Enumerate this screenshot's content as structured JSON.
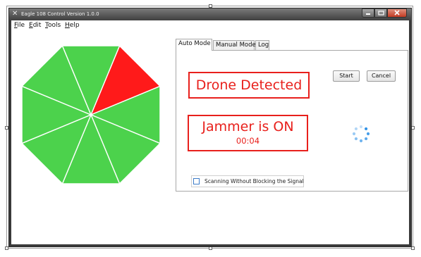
{
  "window": {
    "title": "Eagle 108 Control Version 1.0.0",
    "app_icon": "eagle-x-icon",
    "caption_buttons": [
      "minimize",
      "maximize",
      "close"
    ]
  },
  "menu": {
    "items": [
      {
        "label": "File",
        "mnemonic": "F"
      },
      {
        "label": "Edit",
        "mnemonic": "E"
      },
      {
        "label": "Tools",
        "mnemonic": "T"
      },
      {
        "label": "Help",
        "mnemonic": "H"
      }
    ]
  },
  "sectors": {
    "count": 8,
    "active_sector_index": 0,
    "colors": {
      "inactive": "#4cd24c",
      "active": "#ff1a1a",
      "divider": "#ffffff"
    },
    "states": [
      "active",
      "inactive",
      "inactive",
      "inactive",
      "inactive",
      "inactive",
      "inactive",
      "inactive"
    ]
  },
  "tabs": {
    "items": [
      {
        "label": "Auto Mode",
        "selected": true
      },
      {
        "label": "Manual Mode",
        "selected": false
      },
      {
        "label": "Log",
        "selected": false
      }
    ]
  },
  "auto_mode": {
    "detection_status": "Drone Detected",
    "jammer_status": "Jammer is ON",
    "jammer_timer": "00:04",
    "start_label": "Start",
    "cancel_label": "Cancel",
    "loading_icon": "spinner-icon",
    "scan_option_label": "Scanning Without Blocking the Signal",
    "scan_option_checked": false
  },
  "colors": {
    "alert_red": "#e8201c",
    "checkbox_blue": "#3d7cc8",
    "spinner_blue": "#1e88e5"
  }
}
